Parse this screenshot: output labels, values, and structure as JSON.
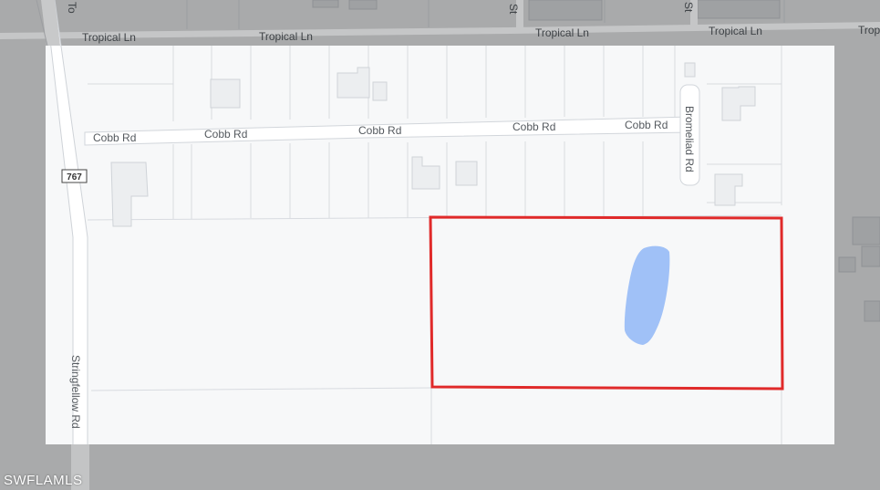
{
  "roads": {
    "tropical": [
      "Tropical Ln",
      "Tropical Ln",
      "Tropical Ln",
      "Tropical Ln",
      "Trop"
    ],
    "cobb": [
      "Cobb Rd",
      "Cobb Rd",
      "Cobb Rd",
      "Cobb Rd",
      "Cobb Rd"
    ],
    "bromeliad": "Bromeliad Rd",
    "stringfellow": "Stringfellow Rd",
    "route_shield": "767",
    "st_a": "St",
    "st_b": "St",
    "top_fragment": "To"
  },
  "watermark": "SWFLAMLS",
  "colors": {
    "land": "#f7f8f9",
    "overlay": "#a9aaab",
    "road": "#ffffff",
    "parcel_line": "#d8dbe0",
    "building": "#eceef0",
    "water": "#a0c1f7",
    "highlight": "#e02a2a"
  }
}
